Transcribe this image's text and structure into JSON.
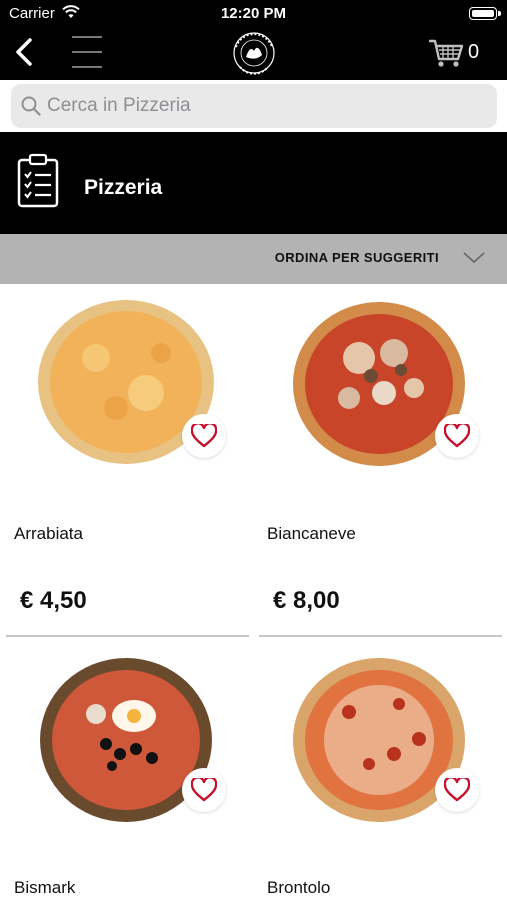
{
  "status_bar": {
    "carrier": "Carrier",
    "time": "12:20 PM"
  },
  "nav": {
    "cart_count": "0",
    "logo_alt": "Ristorante Pizzeria Biancaneve"
  },
  "search": {
    "placeholder": "Cerca in Pizzeria"
  },
  "category": {
    "title": "Pizzeria"
  },
  "sort": {
    "label": "ORDINA PER SUGGERITI"
  },
  "colors": {
    "header_bg": "#000000",
    "sortbar_bg": "#b3b3b3",
    "heart": "#c8102e",
    "search_bg": "#e9e9ea"
  },
  "products": [
    {
      "name": "Arrabiata",
      "price": "€ 4,50",
      "icon": "pizza-margherita"
    },
    {
      "name": "Biancaneve",
      "price": "€ 8,00",
      "icon": "pizza-ham-mushroom"
    },
    {
      "name": "Bismark",
      "price": "",
      "icon": "pizza-egg-olive"
    },
    {
      "name": "Brontolo",
      "price": "",
      "icon": "pizza-salami"
    }
  ]
}
